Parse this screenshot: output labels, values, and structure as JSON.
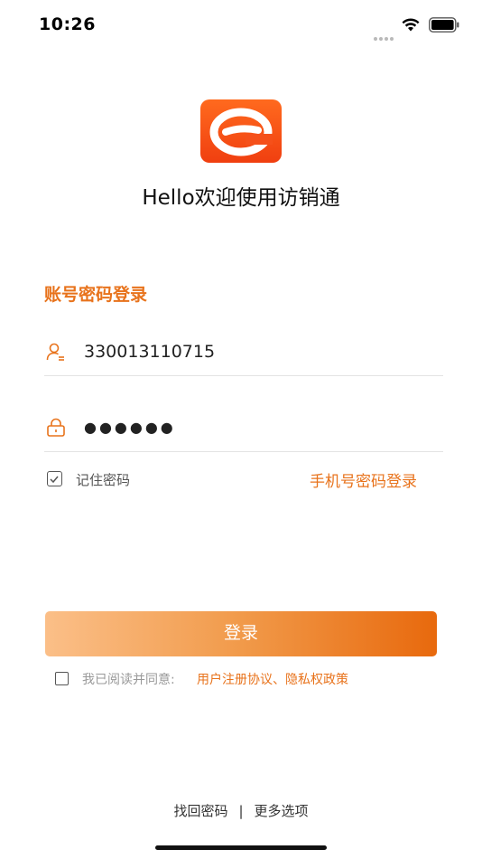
{
  "status": {
    "time": "10:26"
  },
  "app": {
    "welcome": "Hello欢迎使用访销通"
  },
  "login": {
    "section_title": "账号密码登录",
    "username_value": "330013110715",
    "password_mask": "●●●●●●",
    "remember_label": "记住密码",
    "phone_login_label": "手机号密码登录",
    "submit_label": "登录",
    "agree_text": "我已阅读并同意:",
    "agree_link": "用户注册协议、隐私权政策"
  },
  "footer": {
    "find_password": "找回密码",
    "separator": "|",
    "more_options": "更多选项"
  },
  "colors": {
    "accent": "#e8731c",
    "logo": "#f04a12"
  }
}
